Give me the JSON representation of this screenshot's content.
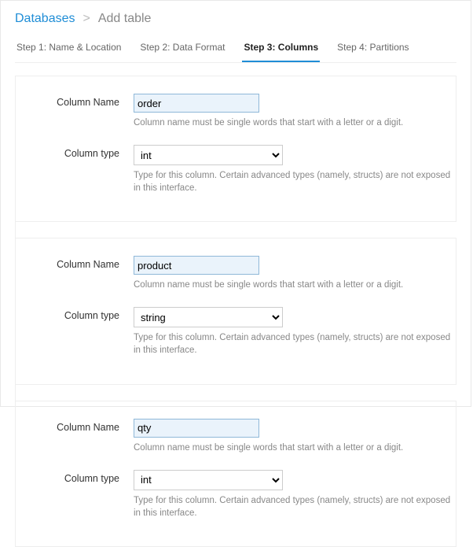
{
  "breadcrumb": {
    "root": "Databases",
    "sep": ">",
    "current": "Add table"
  },
  "tabs": [
    {
      "label": "Step 1: Name & Location",
      "active": false
    },
    {
      "label": "Step 2: Data Format",
      "active": false
    },
    {
      "label": "Step 3: Columns",
      "active": true
    },
    {
      "label": "Step 4: Partitions",
      "active": false
    }
  ],
  "labels": {
    "columnName": "Column Name",
    "columnType": "Column type"
  },
  "hints": {
    "name": "Column name must be single words that start with a letter or a digit.",
    "type": "Type for this column. Certain advanced types (namely, structs) are not exposed in this interface."
  },
  "columns": [
    {
      "name": "order",
      "type": "int"
    },
    {
      "name": "product",
      "type": "string"
    },
    {
      "name": "qty",
      "type": "int"
    }
  ],
  "typeOptions": [
    "int",
    "string"
  ]
}
